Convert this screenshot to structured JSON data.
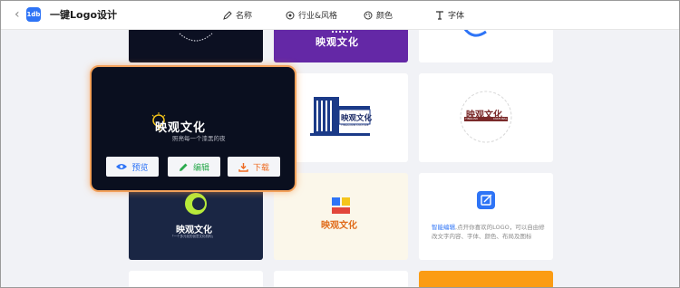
{
  "app": {
    "title": "一键Logo设计",
    "logo_text": "1db"
  },
  "nav": {
    "name": "名称",
    "industry": "行业&风格",
    "color": "颜色",
    "font": "字体"
  },
  "brand": "映观文化",
  "hover_card": {
    "brand": "映观文化",
    "slogan": "照亮每一个漆黑的夜",
    "preview": "预览",
    "edit": "编辑",
    "download": "下载"
  },
  "tiles": {
    "building": {
      "brand": "映观文化",
      "sub": "YINGGUAN CULTURE"
    },
    "stamp": {
      "brand": "映观文化",
      "left": "YINGUAN",
      "right": "CULTURAL"
    },
    "navy": {
      "brand": "映观文化",
      "sub": "「一个多元化的创意文化机构」"
    },
    "cream": {
      "brand": "映观文化"
    },
    "tip": {
      "highlight": "智能编辑",
      "text": ",点开你喜欢的LOGO，可以自由修改文字内容、字体、颜色、布局及图标"
    }
  },
  "colors": {
    "accent": "#2e74f6",
    "edit": "#2aaa4d",
    "download": "#ee6a20",
    "hover_border": "#f3a15a"
  }
}
